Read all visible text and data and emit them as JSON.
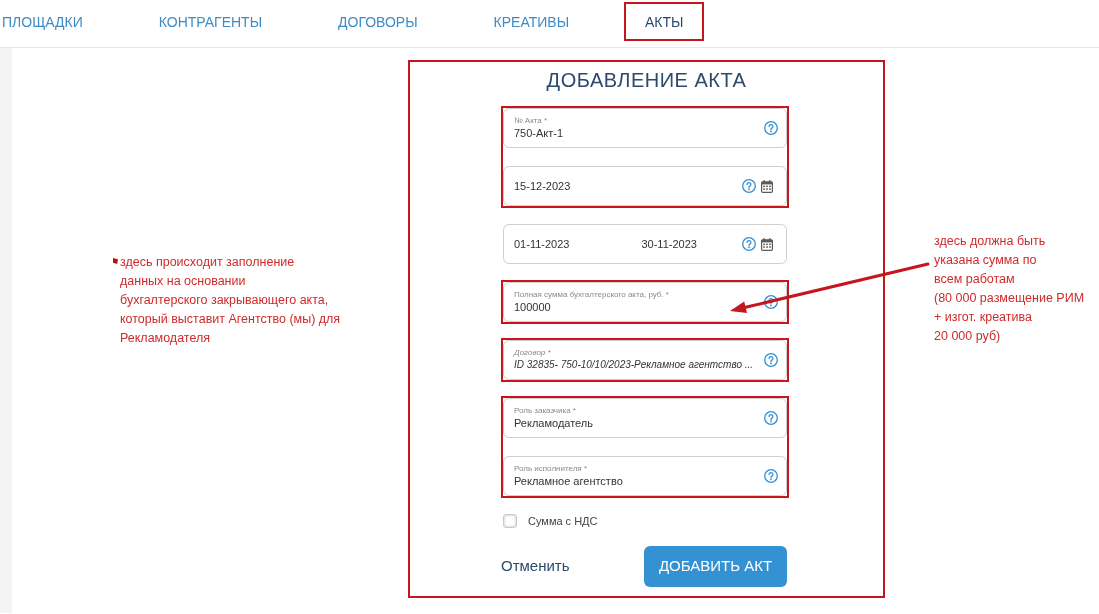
{
  "nav": {
    "tabs": [
      {
        "label": "ПЛОЩАДКИ",
        "selected": false,
        "highlighted": false
      },
      {
        "label": "КОНТРАГЕНТЫ",
        "selected": false,
        "highlighted": false
      },
      {
        "label": "ДОГОВОРЫ",
        "selected": false,
        "highlighted": false
      },
      {
        "label": "КРЕАТИВЫ",
        "selected": false,
        "highlighted": false
      },
      {
        "label": "АКТЫ",
        "selected": true,
        "highlighted": true
      }
    ]
  },
  "left_note": {
    "text": "здесь происходит заполнение\nданных на основании\nбухгалтерского закрывающего акта,\nкоторый выставит Агентство (мы) для\nРекламодателя",
    "marker": true
  },
  "form": {
    "title": "ДОБАВЛЕНИЕ АКТА",
    "highlighted": true,
    "field_groups": [
      {
        "highlighted": true,
        "fields": [
          {
            "kind": "text",
            "label": "№ Акта *",
            "value": "750-Акт-1"
          },
          {
            "kind": "date",
            "value": "15-12-2023"
          }
        ]
      },
      {
        "highlighted": false,
        "fields": [
          {
            "kind": "date_range",
            "values": [
              "01-11-2023",
              "30-11-2023"
            ]
          }
        ]
      },
      {
        "highlighted": true,
        "fields": [
          {
            "kind": "text",
            "label": "Полная сумма бухгалтерского акта, руб. *",
            "value": "100000"
          }
        ]
      },
      {
        "highlighted": true,
        "fields": [
          {
            "kind": "select",
            "label": "Договор *",
            "value": "ID 32835- 750-10/10/2023-Рекламное агентство ..."
          }
        ]
      },
      {
        "highlighted": true,
        "fields": [
          {
            "kind": "text",
            "label": "Роль заказчика *",
            "value": "Рекламодатель"
          },
          {
            "kind": "text",
            "label": "Роль исполнителя *",
            "value": "Рекламное агентство"
          }
        ]
      }
    ],
    "checkbox": {
      "label": "Сумма с НДС",
      "checked": false
    },
    "cancel": "Отменить",
    "submit": "ДОБАВИТЬ АКТ"
  },
  "right_note": {
    "text": "здесь должна быть\nуказана сумма по\nвсем работам\n(80 000 размещение РИМ\n+ изгот. креатива\n20 000 руб)",
    "arrow": true
  }
}
